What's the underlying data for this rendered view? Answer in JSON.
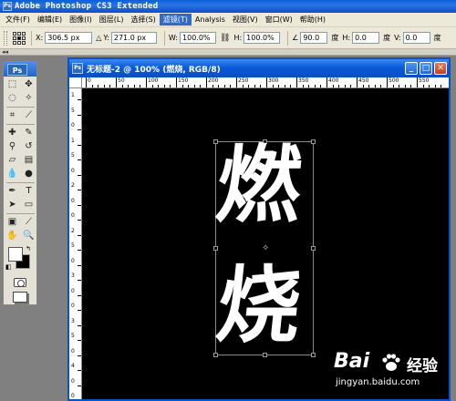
{
  "app": {
    "title": "Adobe Photoshop CS3 Extended",
    "logo": "Ps"
  },
  "menu": {
    "items": [
      "文件(F)",
      "编辑(E)",
      "图像(I)",
      "图层(L)",
      "选择(S)",
      "滤镜(T)",
      "Analysis",
      "视图(V)",
      "窗口(W)",
      "帮助(H)"
    ],
    "active_index": 5
  },
  "options": {
    "x_label": "X:",
    "x_value": "306.5 px",
    "y_label": "Y:",
    "y_value": "271.0 px",
    "w_label": "W:",
    "w_value": "100.0%",
    "h_label": "H:",
    "h_value": "100.0%",
    "angle_value": "90.0",
    "angle_unit": "度",
    "hskew_label": "H:",
    "hskew_value": "0.0",
    "hskew_unit": "度",
    "vskew_label": "V:",
    "vskew_value": "0.0",
    "vskew_unit": "度"
  },
  "document": {
    "title": "无标题-2 @ 100% (燃烧, RGB/8)",
    "ruler_h": [
      "0",
      "50",
      "100",
      "150",
      "200",
      "250",
      "300",
      "350",
      "400",
      "450",
      "500",
      "550"
    ],
    "ruler_v": [
      "1",
      "5",
      "0",
      "1",
      "5",
      "0",
      "2",
      "0",
      "0",
      "2",
      "5",
      "0",
      "3",
      "0",
      "0",
      "3",
      "5",
      "0",
      "4",
      "0",
      "0"
    ],
    "artwork": {
      "char1": "燃",
      "char2": "烧"
    }
  },
  "colors": {
    "foreground": "#ffffff",
    "background": "#000000",
    "accent": "#316ac5"
  },
  "watermark": {
    "logo": "Bai",
    "logo2": "经验",
    "url": "jingyan.baidu.com"
  }
}
